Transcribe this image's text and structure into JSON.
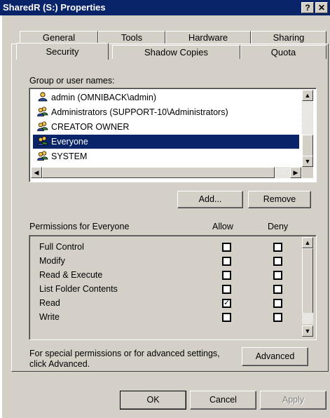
{
  "window": {
    "title": "SharedR (S:) Properties",
    "help_glyph": "?",
    "close_glyph": "✕"
  },
  "tabs": {
    "back_row": [
      "General",
      "Tools",
      "Hardware",
      "Sharing"
    ],
    "front_row": [
      "Security",
      "Shadow Copies",
      "Quota"
    ],
    "active": "Security"
  },
  "group_list": {
    "label": "Group or user names:",
    "items": [
      {
        "name": "admin (OMNIBACK\\admin)",
        "icon": "user-icon"
      },
      {
        "name": "Administrators (SUPPORT-10\\Administrators)",
        "icon": "group-icon"
      },
      {
        "name": "CREATOR OWNER",
        "icon": "group-icon"
      },
      {
        "name": "Everyone",
        "icon": "group-icon",
        "selected": true
      },
      {
        "name": "SYSTEM",
        "icon": "group-icon"
      }
    ]
  },
  "buttons": {
    "add": "Add...",
    "remove": "Remove",
    "advanced": "Advanced",
    "ok": "OK",
    "cancel": "Cancel",
    "apply": "Apply"
  },
  "permissions": {
    "label": "Permissions for Everyone",
    "allow_header": "Allow",
    "deny_header": "Deny",
    "rows": [
      {
        "name": "Full Control",
        "allow": false,
        "deny": false
      },
      {
        "name": "Modify",
        "allow": false,
        "deny": false
      },
      {
        "name": "Read & Execute",
        "allow": false,
        "deny": false
      },
      {
        "name": "List Folder Contents",
        "allow": false,
        "deny": false
      },
      {
        "name": "Read",
        "allow": true,
        "deny": false
      },
      {
        "name": "Write",
        "allow": false,
        "deny": false
      }
    ]
  },
  "advanced_note": {
    "line1": "For special permissions or for advanced settings,",
    "line2": "click Advanced."
  },
  "colors": {
    "titlebar": "#0a246a",
    "face": "#d4d0c8",
    "selection": "#0a246a"
  }
}
